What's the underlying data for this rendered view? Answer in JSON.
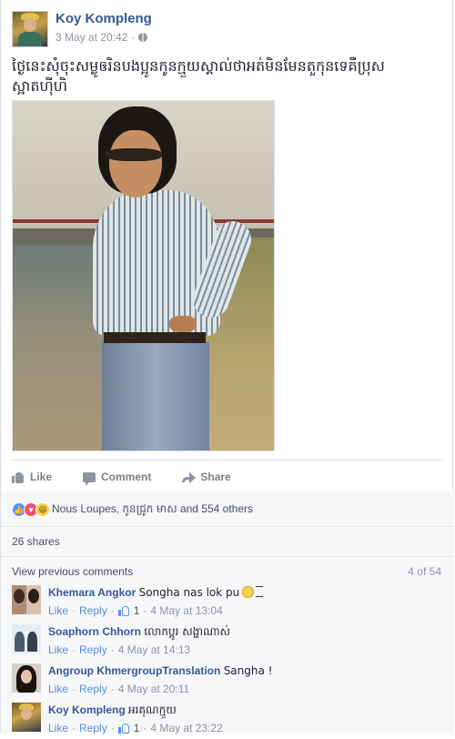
{
  "post": {
    "author": "Koy Kompleng",
    "date": "3 May at 20:42",
    "meta_separator": "·",
    "text": "ថ្ងៃនេះសុំចុះសម្លូឲរិនបងប្អូនកូនក្មួយស្គាល់ថាអត់មិនមែនតួកុនទេគឺប្រុសស្អាតហ៊ីហិ"
  },
  "actions": {
    "like": "Like",
    "comment": "Comment",
    "share": "Share"
  },
  "reactions": {
    "summary": "Nous Loupes, កូនជ្រូក មាស and 554 others",
    "types": [
      "like",
      "love",
      "haha"
    ]
  },
  "shares": "26 shares",
  "comments_header": {
    "view_previous": "View previous comments",
    "count": "4 of 54"
  },
  "comments": [
    {
      "author": "Khemara Angkor",
      "text": "Songha nas lok pu",
      "like_label": "Like",
      "reply_label": "Reply",
      "likes": "1",
      "time": "4 May at 13:04"
    },
    {
      "author": "Soaphorn Chhorn",
      "text": "លោកប្ពូរ សង្ហាណាស់",
      "like_label": "Like",
      "reply_label": "Reply",
      "time": "4 May at 14:13"
    },
    {
      "author": "Angroup KhmergroupTranslation",
      "text": "Sangha !",
      "like_label": "Like",
      "reply_label": "Reply",
      "time": "4 May at 20:11"
    },
    {
      "author": "Koy Kompleng",
      "text": "អរគុណក្មួយ",
      "like_label": "Like",
      "reply_label": "Reply",
      "likes": "1",
      "time": "4 May at 23:22"
    }
  ]
}
